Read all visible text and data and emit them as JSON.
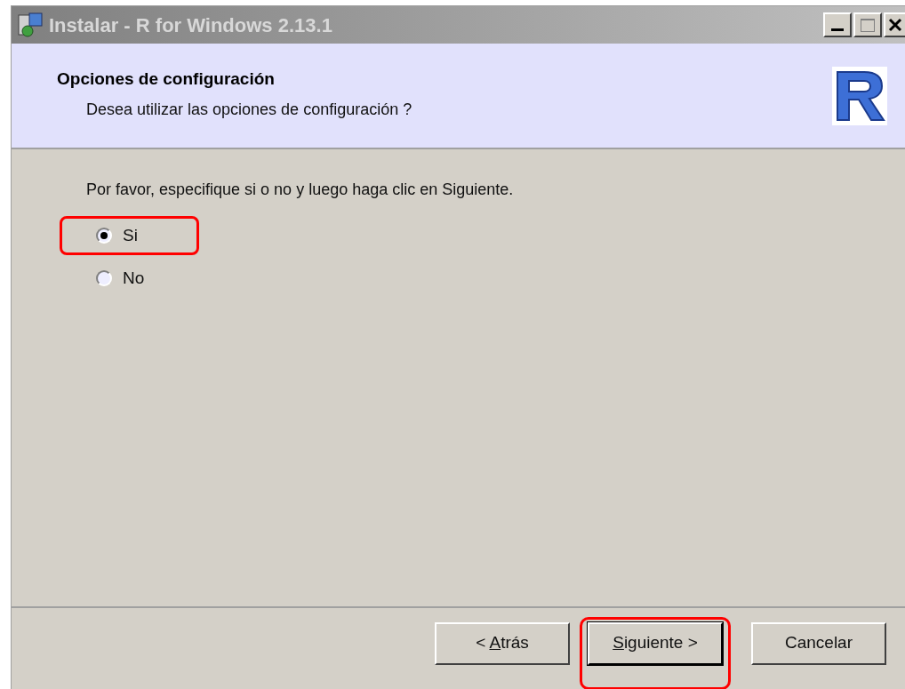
{
  "window": {
    "title": "Instalar - R for Windows 2.13.1"
  },
  "header": {
    "title": "Opciones de configuración",
    "subtitle": "Desea utilizar las opciones de configuración ?"
  },
  "instruction": "Por favor, especifique si o no y luego haga clic en Siguiente.",
  "options": [
    {
      "label": "Si",
      "selected": true,
      "highlighted": true
    },
    {
      "label": "No",
      "selected": false,
      "highlighted": false
    }
  ],
  "buttons": [
    {
      "label_parts": [
        {
          "text": "< ",
          "underlined": false
        },
        {
          "text": "A",
          "underlined": true
        },
        {
          "text": "trás",
          "underlined": false
        }
      ],
      "default": false,
      "highlighted": false
    },
    {
      "label_parts": [
        {
          "text": "S",
          "underlined": true
        },
        {
          "text": "iguiente >",
          "underlined": false
        }
      ],
      "default": true,
      "highlighted": true
    },
    {
      "label_parts": [
        {
          "text": "Cancelar",
          "underlined": false
        }
      ],
      "default": false,
      "highlighted": false
    }
  ]
}
